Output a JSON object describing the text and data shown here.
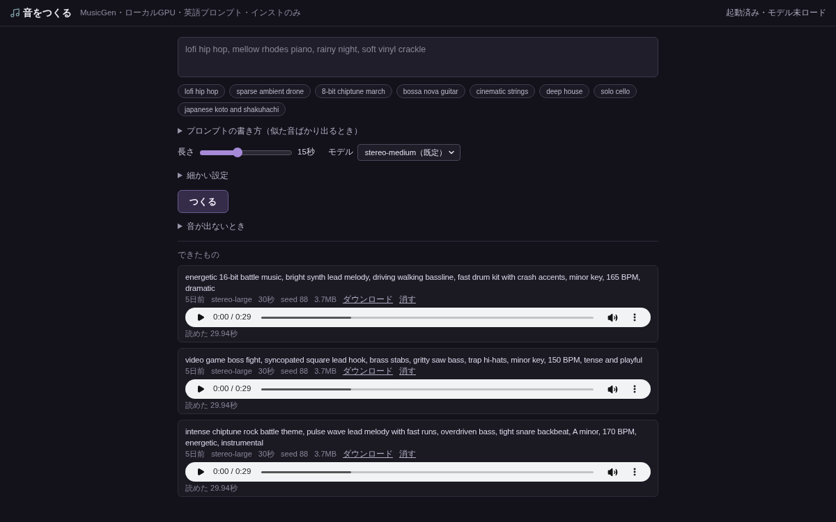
{
  "header": {
    "title": "音をつくる",
    "subtitle": "MusicGen・ローカルGPU・英語プロンプト・インストのみ",
    "status": "起動済み・モデル未ロード"
  },
  "prompt": {
    "placeholder": "lofi hip hop, mellow rhodes piano, rainy night, soft vinyl crackle"
  },
  "presets": [
    "lofi hip hop",
    "sparse ambient drone",
    "8-bit chiptune march",
    "bossa nova guitar",
    "cinematic strings",
    "deep house",
    "solo cello",
    "japanese koto and shakuhachi"
  ],
  "prompt_help": {
    "label": "プロンプトの書き方（似た音ばかり出るとき）",
    "expanded": false
  },
  "length": {
    "label": "長さ",
    "level": 0.41,
    "reading": "15秒"
  },
  "model": {
    "label": "モデル",
    "value": "stereo-medium（既定）"
  },
  "advanced": {
    "label": "細かい設定",
    "expanded": false
  },
  "generate_button": "つくる",
  "no_sound_help": {
    "label": "音が出ないとき",
    "expanded": false
  },
  "results": {
    "heading": "できたもの",
    "items": [
      {
        "prompt": "energetic 16-bit battle music, bright synth lead melody, driving walking bassline, fast drum kit with crash accents, minor key, 165 BPM, dramatic",
        "meta": [
          "5日前",
          "stereo-large",
          "30秒",
          "seed 88",
          "3.7MB"
        ],
        "links": [
          "ダウンロード",
          "消す"
        ],
        "player": {
          "time": "0:00 / 0:29",
          "level": 0.27
        },
        "load_time": "読めた 29.94秒"
      },
      {
        "prompt": "video game boss fight, syncopated square lead hook, brass stabs, gritty saw bass, trap hi-hats, minor key, 150 BPM, tense and playful",
        "meta": [
          "5日前",
          "stereo-large",
          "30秒",
          "seed 88",
          "3.7MB"
        ],
        "links": [
          "ダウンロード",
          "消す"
        ],
        "player": {
          "time": "0:00 / 0:29",
          "level": 0.27
        },
        "load_time": "読めた 29.94秒"
      },
      {
        "prompt": "intense chiptune rock battle theme, pulse wave lead melody with fast runs, overdriven bass, tight snare backbeat, A minor, 170 BPM, energetic, instrumental",
        "meta": [
          "5日前",
          "stereo-large",
          "30秒",
          "seed 88",
          "3.7MB"
        ],
        "links": [
          "ダウンロード",
          "消す"
        ],
        "player": {
          "time": "0:00 / 0:29",
          "level": 0.27
        },
        "load_time": "読めた 29.94秒"
      }
    ]
  }
}
